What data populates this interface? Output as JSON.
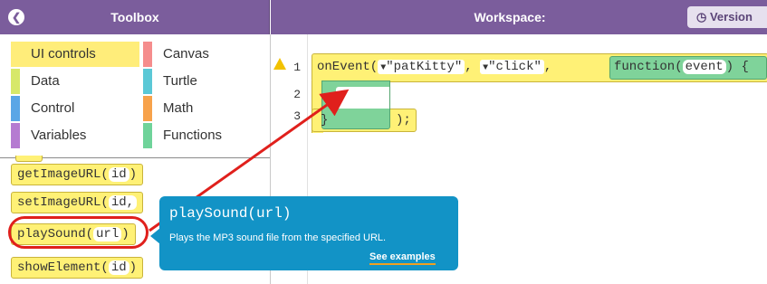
{
  "toolbox": {
    "title": "Toolbox",
    "collapse_icon": "chevron-left-icon",
    "categories": [
      {
        "label": "UI controls",
        "color": "#ffed7a",
        "selected": true
      },
      {
        "label": "Canvas",
        "color": "#f58d8d"
      },
      {
        "label": "Data",
        "color": "#d7e86a"
      },
      {
        "label": "Turtle",
        "color": "#5bc8d6"
      },
      {
        "label": "Control",
        "color": "#5aa6e6"
      },
      {
        "label": "Math",
        "color": "#f7a24b"
      },
      {
        "label": "Variables",
        "color": "#b57bd1"
      },
      {
        "label": "Functions",
        "color": "#6fd39a"
      }
    ],
    "blocks": [
      {
        "name": "getImageURL",
        "param": "id",
        "trail": ")"
      },
      {
        "name": "setImageURL",
        "param": "id,",
        "trail": ""
      },
      {
        "name": "playSound",
        "param": "url",
        "trail": ")"
      },
      {
        "name": "showElement",
        "param": "id",
        "trail": ")"
      }
    ]
  },
  "workspace": {
    "title": "Workspace:",
    "version_button": "Version",
    "version_icon": "clock-icon",
    "line_numbers": [
      "1",
      "2",
      "3"
    ],
    "warning_icon": "warning-icon",
    "code": {
      "event_fn": "onEvent(",
      "arg1": "\"patKitty\"",
      "arg2": "\"click\"",
      "sep": ",",
      "fn_kw": "function(",
      "fn_param": "event",
      "fn_close": ") {",
      "close_brace": "}",
      "close_stmt": ");"
    }
  },
  "tooltip": {
    "signature": "playSound(url)",
    "description": "Plays the MP3 sound file from the specified URL.",
    "link": "See examples"
  },
  "annotation": {
    "color": "#e0201c"
  },
  "colors": {
    "header": "#7b5d9c",
    "tooltip": "#1293c6",
    "block_yellow": "#fff176",
    "block_green": "#7fd39a"
  }
}
